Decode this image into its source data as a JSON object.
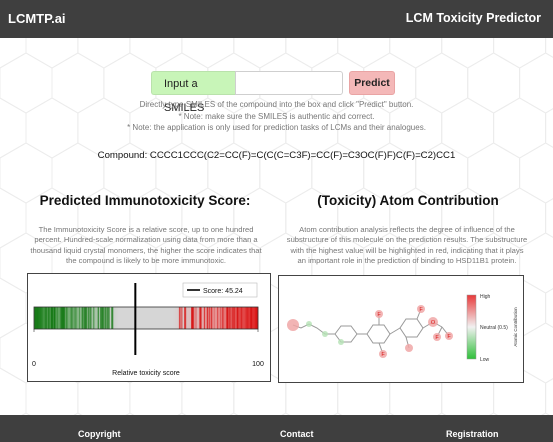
{
  "header": {
    "brand": "LCMTP.ai",
    "title": "LCM Toxicity Predictor"
  },
  "input": {
    "label": "Input a SMILES",
    "value": "",
    "placeholder": "",
    "predict_label": "Predict"
  },
  "hints": [
    "Directly type SMILES of the compound into the box and click \"Predict\" button.",
    "* Note: make sure the SMILES is authentic and correct.",
    "* Note: the application is only used for prediction tasks of LCMs and their analogues."
  ],
  "compound": "Compound: CCCC1CCC(C2=CC(F)=C(C(C=C3F)=CC(F)=C3OC(F)F)C(F)=C2)CC1",
  "immunotoxicity": {
    "title": "Predicted Immunotoxicity Score:",
    "description_lines": [
      "The Immunotoxicity Score is a relative score, up to one hundred",
      "percent. Hundred-scale normalization using data from more than a",
      "thousand liquid crystal monomers, the higher the score indicates that",
      "the compound is likely to be more immunotoxic."
    ],
    "legend_label": "Score: 45.24",
    "xlabel": "Relative toxicity score",
    "ticks": [
      "0",
      "100"
    ]
  },
  "chart_data": {
    "type": "bar",
    "title": "",
    "xlabel": "Relative toxicity score",
    "xlim": [
      0,
      100
    ],
    "score": 45.24,
    "series": [
      {
        "name": "Score: 45.24",
        "values": [
          45.24
        ]
      }
    ],
    "gradient": [
      "green",
      "light gray",
      "red"
    ],
    "legend_position": "top-right"
  },
  "atom_contribution": {
    "title": "(Toxicity) Atom Contribution",
    "description_lines": [
      "Atom contribution analysis reflects the degree of influence of the",
      "substructure of this molecule on the prediction results. The substructure",
      "with the highest value will be highlighted in red, indicating that it plays",
      "an important role in the prediction of binding to HSD11B1 protein."
    ],
    "colorbar": {
      "high": "High",
      "mid": "Neutral (0.5)",
      "low": "Low",
      "label": "Atomic Contribution"
    },
    "atoms": [
      "F",
      "F",
      "F",
      "F",
      "F",
      "O"
    ]
  },
  "footer": {
    "links": [
      "Copyright",
      "Contact",
      "Registration"
    ]
  },
  "colors": {
    "header_bg": "#3f3f3f",
    "input_label_bg": "#c8f5b8",
    "predict_bg": "#f4b8b8",
    "high": "#e8393a",
    "low": "#22a52c"
  }
}
